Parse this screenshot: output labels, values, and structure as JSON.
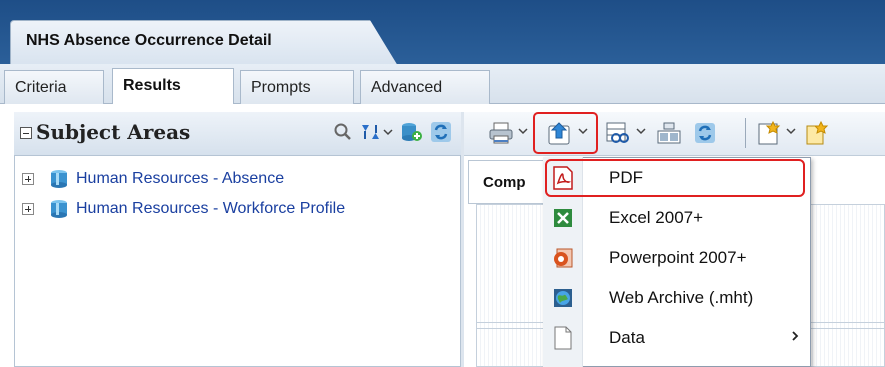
{
  "window": {
    "title": "NHS Absence Occurrence Detail"
  },
  "tabs": [
    {
      "label": "Criteria",
      "active": false
    },
    {
      "label": "Results",
      "active": true
    },
    {
      "label": "Prompts",
      "active": false
    },
    {
      "label": "Advanced",
      "active": false
    }
  ],
  "subject_areas": {
    "title": "Subject Areas",
    "items": [
      {
        "label": "Human Resources - Absence",
        "icon": "cylinder-icon"
      },
      {
        "label": "Human Resources - Workforce Profile",
        "icon": "cylinder-icon"
      }
    ]
  },
  "compound": {
    "label": "Comp"
  },
  "export_menu": {
    "items": [
      {
        "label": "PDF",
        "icon": "pdf-icon",
        "highlighted": true
      },
      {
        "label": "Excel 2007+",
        "icon": "excel-icon"
      },
      {
        "label": "Powerpoint 2007+",
        "icon": "powerpoint-icon"
      },
      {
        "label": "Web Archive (.mht)",
        "icon": "globe-icon"
      },
      {
        "label": "Data",
        "icon": "document-icon",
        "has_submenu": true
      }
    ]
  },
  "colors": {
    "header_band": "#1e4e87",
    "highlight_red": "#e02020",
    "link_blue": "#1a3fa0"
  }
}
